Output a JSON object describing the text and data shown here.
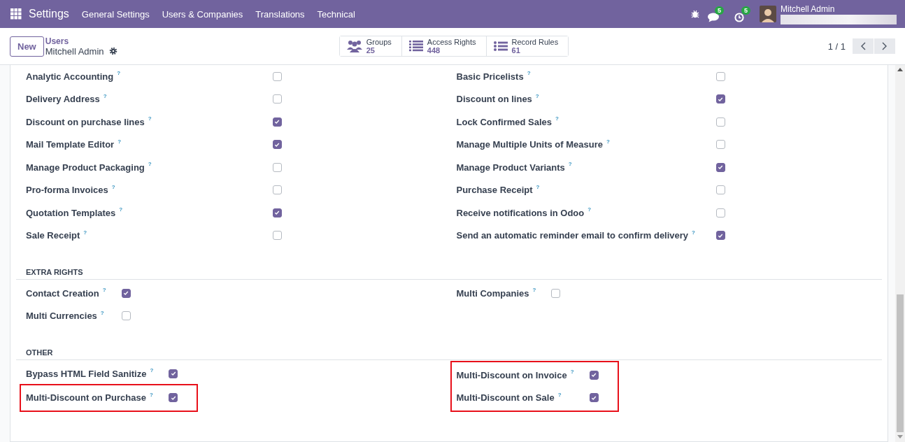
{
  "navbar": {
    "app_name": "Settings",
    "menu": [
      {
        "label": "General Settings"
      },
      {
        "label": "Users & Companies"
      },
      {
        "label": "Translations"
      },
      {
        "label": "Technical"
      }
    ],
    "messages_count": "5",
    "activities_count": "5",
    "user_name": "Mitchell Admin"
  },
  "control_panel": {
    "new_button": "New",
    "breadcrumb": "Users",
    "record_name": "Mitchell Admin",
    "stat_buttons": [
      {
        "kind": "groups",
        "label": "Groups",
        "value": "25"
      },
      {
        "kind": "list",
        "label": "Access Rights",
        "value": "448"
      },
      {
        "kind": "bullets",
        "label": "Record Rules",
        "value": "61"
      }
    ],
    "pager": "1 / 1"
  },
  "sections": [
    {
      "kind": "wide",
      "columns": [
        [
          {
            "label": "Analytic Accounting",
            "help": "?",
            "checked": false,
            "highlighted": false
          },
          {
            "label": "Delivery Address",
            "help": "?",
            "checked": false,
            "highlighted": false
          },
          {
            "label": "Discount on purchase lines",
            "help": "?",
            "checked": true,
            "highlighted": false
          },
          {
            "label": "Mail Template Editor",
            "help": "?",
            "checked": true,
            "highlighted": false
          },
          {
            "label": "Manage Product Packaging",
            "help": "?",
            "checked": false,
            "highlighted": false
          },
          {
            "label": "Pro-forma Invoices",
            "help": "?",
            "checked": false,
            "highlighted": false
          },
          {
            "label": "Quotation Templates",
            "help": "?",
            "checked": true,
            "highlighted": false
          },
          {
            "label": "Sale Receipt",
            "help": "?",
            "checked": false,
            "highlighted": false
          }
        ],
        [
          {
            "label": "Basic Pricelists",
            "help": "?",
            "checked": false,
            "highlighted": false
          },
          {
            "label": "Discount on lines",
            "help": "?",
            "checked": true,
            "highlighted": false
          },
          {
            "label": "Lock Confirmed Sales",
            "help": "?",
            "checked": false,
            "highlighted": false
          },
          {
            "label": "Manage Multiple Units of Measure",
            "help": "?",
            "checked": false,
            "highlighted": false
          },
          {
            "label": "Manage Product Variants",
            "help": "?",
            "checked": true,
            "highlighted": false
          },
          {
            "label": "Purchase Receipt",
            "help": "?",
            "checked": false,
            "highlighted": false
          },
          {
            "label": "Receive notifications in Odoo",
            "help": "?",
            "checked": false,
            "highlighted": false
          },
          {
            "label": "Send an automatic reminder email to confirm delivery",
            "help": "?",
            "checked": true,
            "highlighted": false
          }
        ]
      ]
    },
    {
      "kind": "compact",
      "heading": "EXTRA RIGHTS",
      "columns": [
        [
          {
            "label": "Contact Creation",
            "help": "?",
            "checked": true,
            "highlighted": false
          },
          {
            "label": "Multi Currencies",
            "help": "?",
            "checked": false,
            "highlighted": false
          }
        ],
        [
          {
            "label": "Multi Companies",
            "help": "?",
            "checked": false,
            "highlighted": false
          }
        ]
      ]
    },
    {
      "kind": "compact",
      "heading": "OTHER",
      "columns": [
        [
          {
            "label": "Bypass HTML Field Sanitize",
            "help": "?",
            "checked": true,
            "highlighted": false
          },
          {
            "label": "Multi-Discount on Purchase",
            "help": "?",
            "checked": true,
            "highlighted": true
          }
        ],
        [
          {
            "label": "Multi-Discount on Invoice",
            "help": "?",
            "checked": true,
            "highlighted": true
          },
          {
            "label": "Multi-Discount on Sale",
            "help": "?",
            "checked": true,
            "highlighted": true
          }
        ]
      ]
    }
  ]
}
